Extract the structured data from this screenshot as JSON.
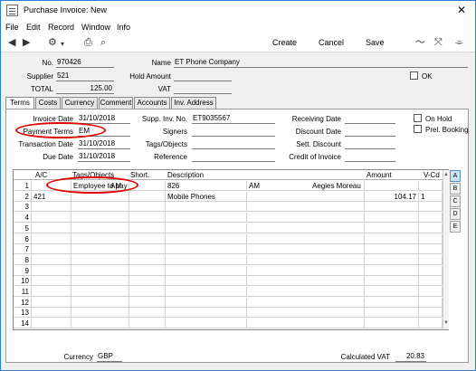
{
  "window": {
    "title": "Purchase Invoice: New",
    "close_glyph": "✕"
  },
  "menu": [
    "File",
    "Edit",
    "Record",
    "Window",
    "Info"
  ],
  "toolbar": {
    "create": "Create",
    "cancel": "Cancel",
    "save": "Save"
  },
  "header": {
    "no_label": "No.",
    "no_value": "970426",
    "name_label": "Name",
    "name_value": "ET Phone Company",
    "supplier_label": "Supplier",
    "supplier_value": "521",
    "hold_amount_label": "Hold Amount",
    "hold_amount_value": "",
    "ok_label": "OK",
    "total_label": "TOTAL",
    "total_value": "125.00",
    "vat_label": "VAT",
    "vat_value": ""
  },
  "tabs": [
    "Terms",
    "Costs",
    "Currency",
    "Comment",
    "Accounts",
    "Inv. Address"
  ],
  "terms": {
    "invoice_date_label": "Invoice Date",
    "invoice_date": "31/10/2018",
    "payment_terms_label": "Payment Terms",
    "payment_terms": "EM",
    "transaction_date_label": "Transaction Date",
    "transaction_date": "31/10/2018",
    "due_date_label": "Due Date",
    "due_date": "31/10/2018",
    "supp_inv_no_label": "Supp. Inv. No.",
    "supp_inv_no": "ET9035567",
    "signers_label": "Signers",
    "signers": "",
    "tags_objects_label": "Tags/Objects",
    "tags_objects": "",
    "reference_label": "Reference",
    "reference": "",
    "receiving_date_label": "Receiving Date",
    "receiving_date": "",
    "discount_date_label": "Discount Date",
    "discount_date": "",
    "sett_discount_label": "Sett. Discount",
    "sett_discount": "",
    "credit_of_invoice_label": "Credit of Invoice",
    "credit_of_invoice": "",
    "on_hold_label": "On Hold",
    "prel_booking_label": "Prel. Booking"
  },
  "grid": {
    "columns": [
      "A/C",
      "Tags/Objects",
      "Short.",
      "Description",
      "Amount",
      "V-Cd"
    ],
    "rows": [
      {
        "num": "1",
        "ac": "",
        "tags": "Employee to pay",
        "short_pre": "AM",
        "short": "",
        "desc": "826",
        "desc2": "AM",
        "desc3": "Aegies Moreau",
        "amount": "",
        "vcd": ""
      },
      {
        "num": "2",
        "ac": "421",
        "tags": "",
        "short_pre": "",
        "short": "",
        "desc": "Mobile Phones",
        "desc2": "",
        "desc3": "",
        "amount": "104.17",
        "vcd": "1"
      },
      {
        "num": "3"
      },
      {
        "num": "4"
      },
      {
        "num": "5"
      },
      {
        "num": "6"
      },
      {
        "num": "7"
      },
      {
        "num": "8"
      },
      {
        "num": "9"
      },
      {
        "num": "10"
      },
      {
        "num": "11"
      },
      {
        "num": "12"
      },
      {
        "num": "13"
      },
      {
        "num": "14"
      }
    ],
    "side_tabs": [
      "A",
      "B",
      "C",
      "D",
      "E"
    ]
  },
  "footer": {
    "currency_label": "Currency",
    "currency": "GBP",
    "calc_vat_label": "Calculated VAT",
    "calc_vat": "20.83"
  },
  "annotation_color": "#e00000"
}
